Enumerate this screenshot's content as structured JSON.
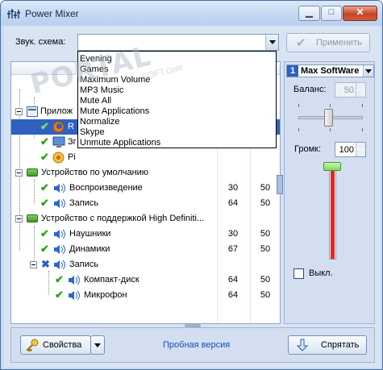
{
  "window": {
    "title": "Power Mixer",
    "minimize": "▁",
    "maximize": "□",
    "close": "✕"
  },
  "toolbar": {
    "scheme_label": "Звук. схема:",
    "scheme_value": "",
    "apply_label": "Применить"
  },
  "scheme_dropdown": {
    "options": [
      "Evening",
      "Games",
      "Maximum Volume",
      "MP3 Music",
      "Mute All",
      "Mute Applications",
      "Normalize",
      "Skype",
      "Unmute Applications"
    ]
  },
  "watermark": {
    "text": "PORTAL",
    "small": "SOFT.com"
  },
  "tree": {
    "rows": [
      {
        "label": "Прилож",
        "v1": "",
        "v2": ""
      },
      {
        "label": "R",
        "v1": "",
        "v2": ""
      },
      {
        "label": "Зг",
        "v1": "",
        "v2": ""
      },
      {
        "label": "Pi",
        "v1": "",
        "v2": ""
      },
      {
        "label": "Устройство по умолчанию",
        "v1": "",
        "v2": ""
      },
      {
        "label": "Воспроизведение",
        "v1": "30",
        "v2": "50"
      },
      {
        "label": "Запись",
        "v1": "64",
        "v2": "50"
      },
      {
        "label": "Устройство с поддержкой High Definiti...",
        "v1": "",
        "v2": ""
      },
      {
        "label": "Наушники",
        "v1": "30",
        "v2": "50"
      },
      {
        "label": "Динамики",
        "v1": "67",
        "v2": "50"
      },
      {
        "label": "Запись",
        "v1": "",
        "v2": ""
      },
      {
        "label": "Компакт-диск",
        "v1": "64",
        "v2": "50"
      },
      {
        "label": "Микрофон",
        "v1": "64",
        "v2": "50"
      }
    ]
  },
  "device_panel": {
    "number": "1",
    "device_name": "Max SoftWare",
    "balance_label": "Баланс:",
    "balance_value": "50",
    "volume_label": "Громк:",
    "volume_value": "100",
    "volume_level": 1.0,
    "mute_label": "Выкл."
  },
  "bottom": {
    "properties_label": "Свойства",
    "trial_text": "Пробная версия",
    "hide_label": "Спрятать"
  },
  "colors": {
    "selection": "#2f62bf",
    "trial_link": "#1a49b4",
    "check_green": "#2aa317"
  }
}
